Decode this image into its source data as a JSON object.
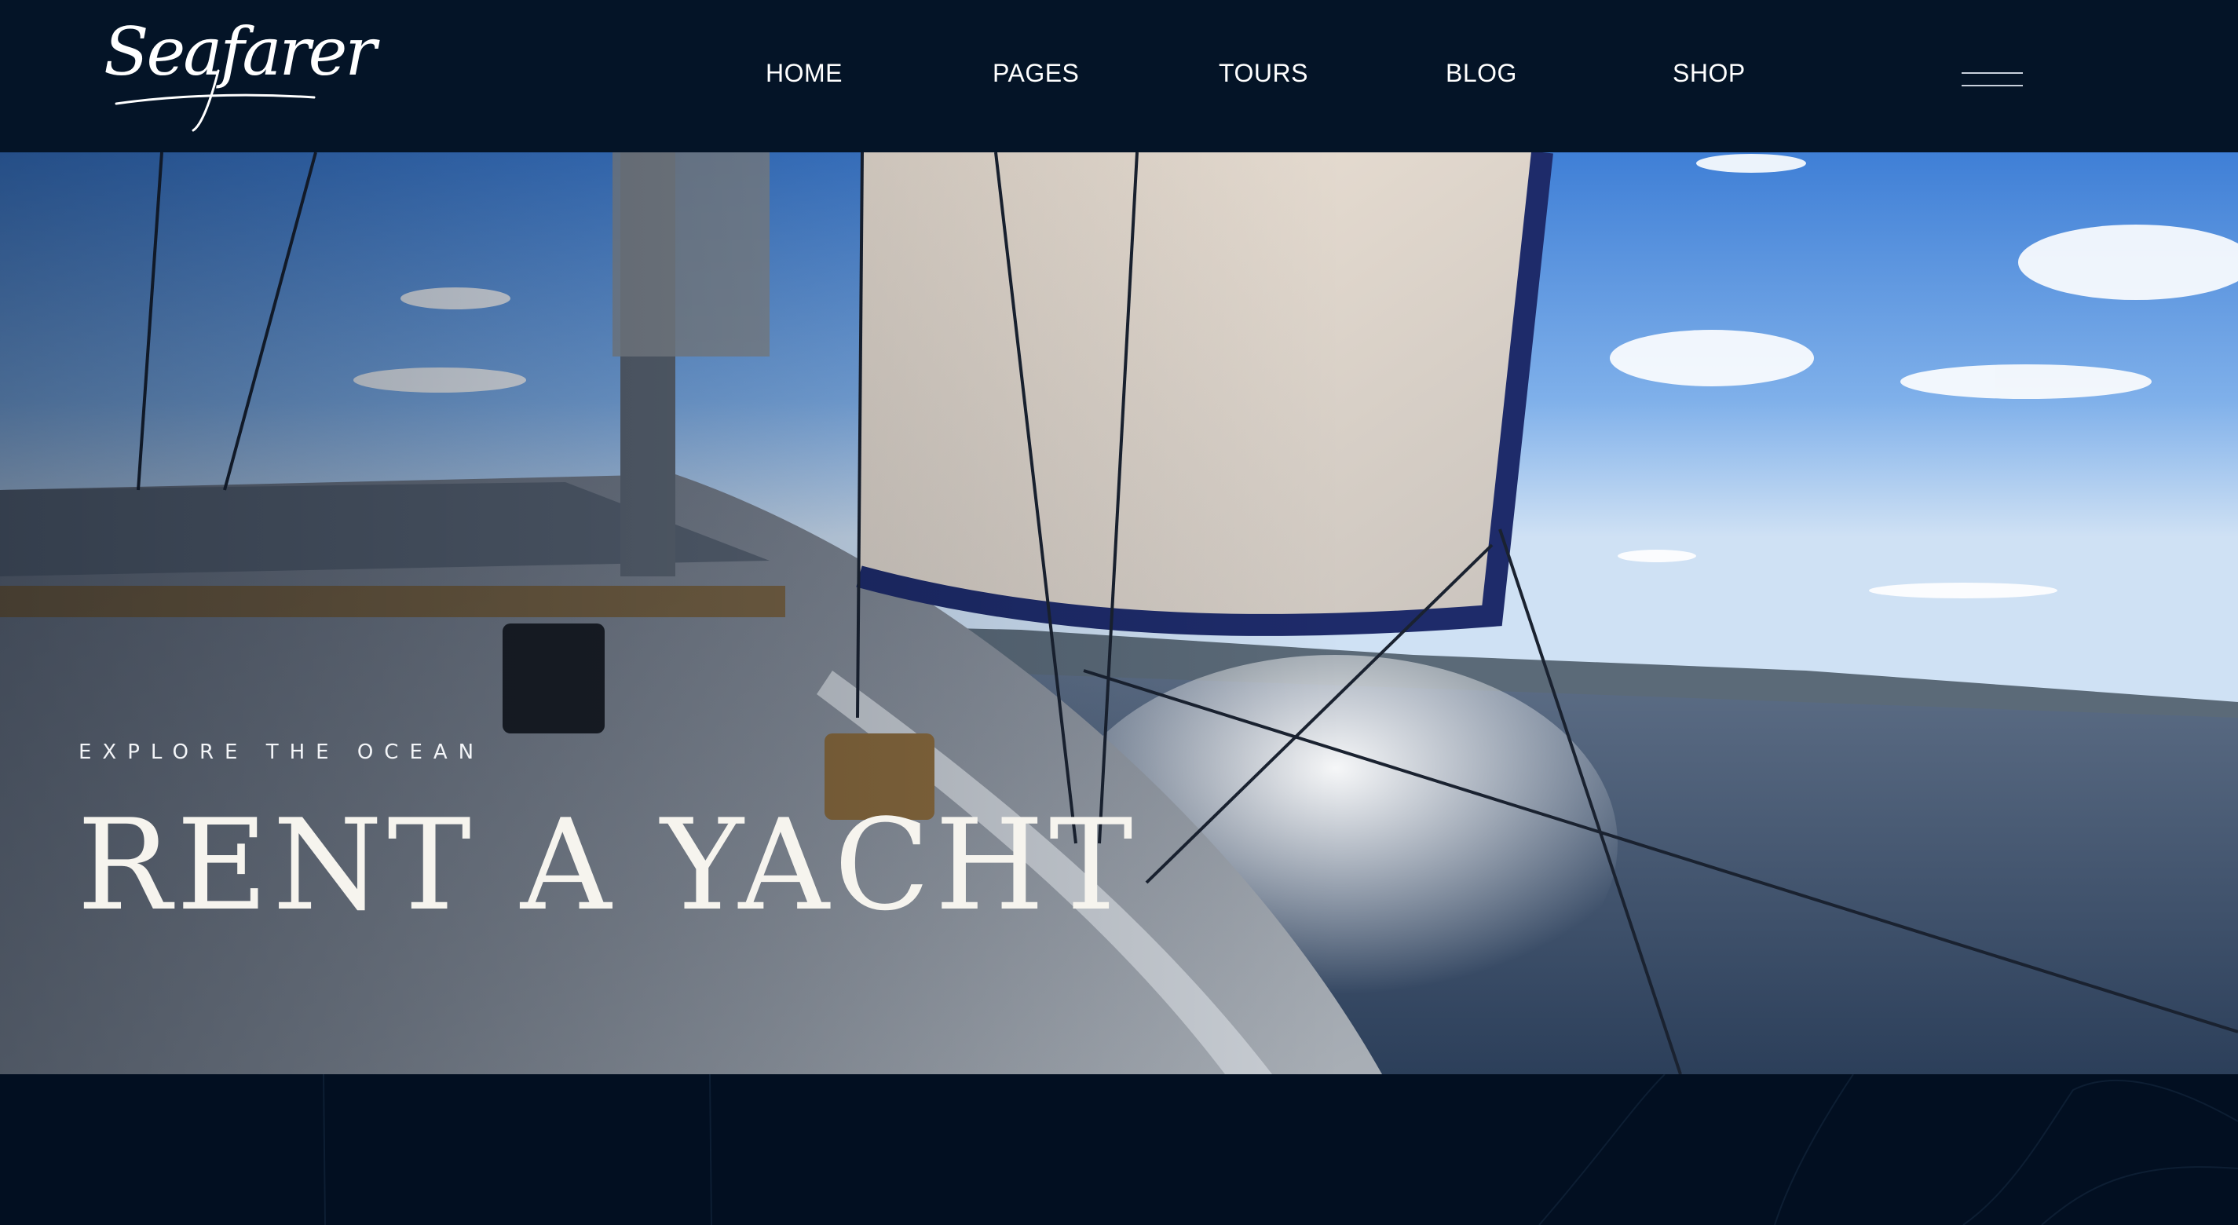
{
  "brand": {
    "logo_text": "Seafarer"
  },
  "nav": {
    "items": [
      {
        "label": "HOME"
      },
      {
        "label": "PAGES"
      },
      {
        "label": "TOURS"
      },
      {
        "label": "BLOG"
      },
      {
        "label": "SHOP"
      }
    ],
    "menu_icon": "hamburger-icon"
  },
  "hero": {
    "eyebrow": "EXPLORE THE OCEAN",
    "headline": "RENT A YACHT",
    "image_subject": "sailboat deck with sail on open water"
  },
  "colors": {
    "header_bg": "#041427",
    "page_bg": "#020f21",
    "text": "#ffffff"
  }
}
